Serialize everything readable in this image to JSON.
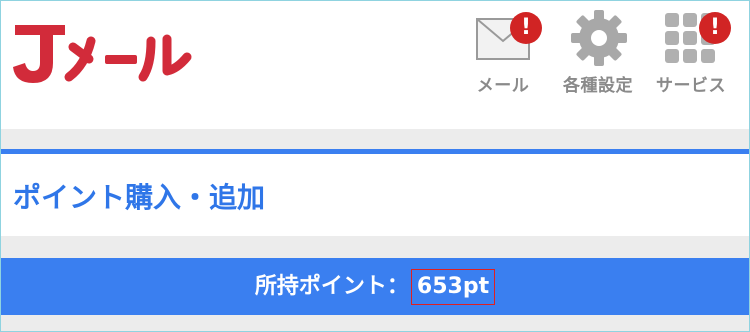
{
  "header": {
    "logo_text": "Jメール",
    "nav": [
      {
        "label": "メール",
        "icon": "mail-icon",
        "badge": "!"
      },
      {
        "label": "各種設定",
        "icon": "gear-icon",
        "badge": ""
      },
      {
        "label": "サービス",
        "icon": "grid-icon",
        "badge": "!"
      }
    ]
  },
  "main": {
    "title": "ポイント購入・追加",
    "points_label": "所持ポイント：",
    "points_value": "653pt"
  },
  "colors": {
    "accent_blue": "#3a7ff0",
    "title_blue": "#2f76e8",
    "badge_red": "#d12424",
    "logo_red": "#d22b3a"
  }
}
